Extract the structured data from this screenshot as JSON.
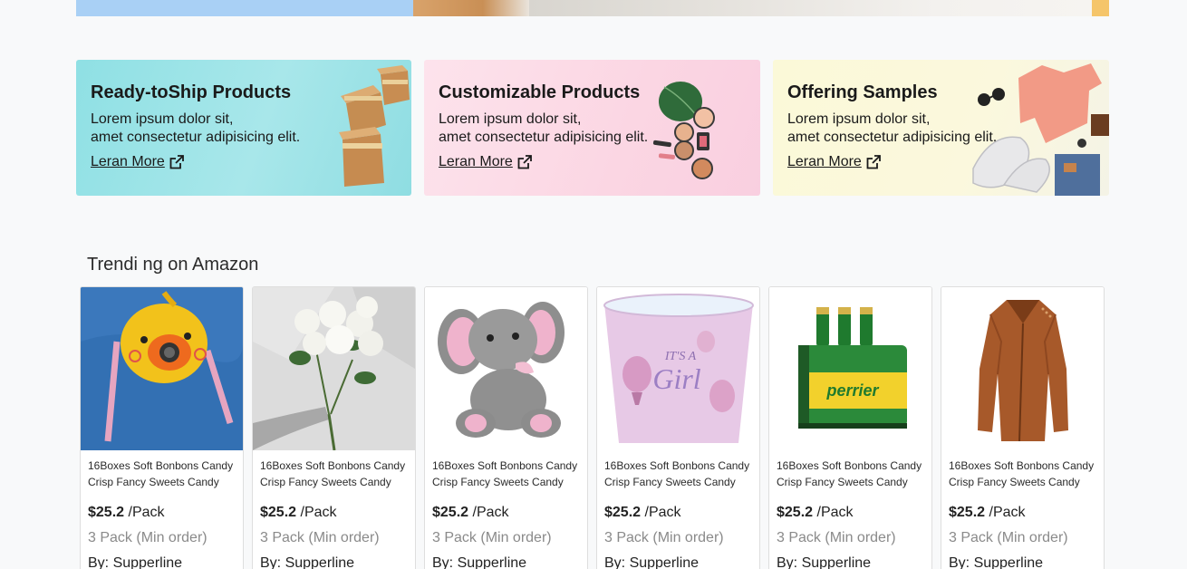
{
  "promos": [
    {
      "title": "Ready-toShip Products",
      "line1": "Lorem ipsum dolor sit,",
      "line2": "amet consectetur adipisicing elit.",
      "link": "Leran More"
    },
    {
      "title": "Customizable Products",
      "line1": "Lorem ipsum dolor sit,",
      "line2": "amet consectetur adipisicing elit.",
      "link": "Leran More"
    },
    {
      "title": "Offering Samples",
      "line1": "Lorem ipsum dolor sit,",
      "line2": "amet consectetur adipisicing elit.",
      "link": "Leran More"
    }
  ],
  "trending": {
    "title": "Trendi ng on Amazon",
    "products": [
      {
        "name": "16Boxes Soft Bonbons Candy Crisp Fancy Sweets Candy",
        "price": "$25.2",
        "unit": " /Pack",
        "moq": "3 Pack (Min order)",
        "seller": "By: Supperline",
        "image": "duck-camera-toy"
      },
      {
        "name": "16Boxes Soft Bonbons Candy Crisp Fancy Sweets Candy",
        "price": "$25.2",
        "unit": " /Pack",
        "moq": "3 Pack (Min order)",
        "seller": "By: Supperline",
        "image": "white-flower-bouquet"
      },
      {
        "name": "16Boxes Soft Bonbons Candy Crisp Fancy Sweets Candy",
        "price": "$25.2",
        "unit": " /Pack",
        "moq": "3 Pack (Min order)",
        "seller": "By: Supperline",
        "image": "plush-elephant"
      },
      {
        "name": "16Boxes Soft Bonbons Candy Crisp Fancy Sweets Candy",
        "price": "$25.2",
        "unit": " /Pack",
        "moq": "3 Pack (Min order)",
        "seller": "By: Supperline",
        "image": "its-a-girl-bucket"
      },
      {
        "name": "16Boxes Soft Bonbons Candy Crisp Fancy Sweets Candy",
        "price": "$25.2",
        "unit": " /Pack",
        "moq": "3 Pack (Min order)",
        "seller": "By: Supperline",
        "image": "perrier-bottles"
      },
      {
        "name": "16Boxes Soft Bonbons Candy Crisp Fancy Sweets Candy",
        "price": "$25.2",
        "unit": " /Pack",
        "moq": "3 Pack (Min order)",
        "seller": "By: Supperline",
        "image": "brown-leather-jacket"
      }
    ]
  },
  "product_image_texts": {
    "bucket": "IT'S A",
    "bucket_big": "Girl",
    "perrier": "perrier"
  },
  "colors": {
    "card1": "#9fe3e7",
    "card2": "#fbd8e4",
    "card3": "#fbf9d8",
    "background": "#f8f9fa"
  }
}
